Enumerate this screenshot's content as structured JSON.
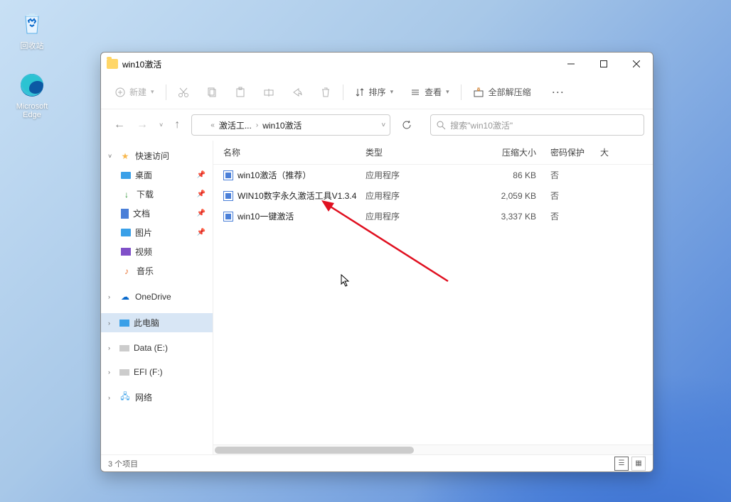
{
  "desktop": {
    "recycle": "回收站",
    "edge": "Microsoft Edge"
  },
  "window": {
    "title": "win10激活"
  },
  "toolbar": {
    "new": "新建",
    "sort": "排序",
    "view": "查看",
    "extract_all": "全部解压缩"
  },
  "breadcrumb": {
    "part1": "激活工...",
    "part2": "win10激活"
  },
  "search": {
    "placeholder": "搜索\"win10激活\""
  },
  "sidebar": {
    "quick_access": "快速访问",
    "desktop": "桌面",
    "downloads": "下载",
    "documents": "文档",
    "pictures": "图片",
    "videos": "视频",
    "music": "音乐",
    "onedrive": "OneDrive",
    "this_pc": "此电脑",
    "data_e": "Data (E:)",
    "efi_f": "EFI (F:)",
    "network": "网络"
  },
  "columns": {
    "name": "名称",
    "type": "类型",
    "compressed_size": "压缩大小",
    "password_protected": "密码保护",
    "size": "大"
  },
  "files": [
    {
      "name": "win10激活（推荐）",
      "type": "应用程序",
      "size": "86 KB",
      "pwd": "否"
    },
    {
      "name": "WIN10数字永久激活工具V1.3.4",
      "type": "应用程序",
      "size": "2,059 KB",
      "pwd": "否"
    },
    {
      "name": "win10一键激活",
      "type": "应用程序",
      "size": "3,337 KB",
      "pwd": "否"
    }
  ],
  "status": {
    "items": "3 个项目"
  }
}
